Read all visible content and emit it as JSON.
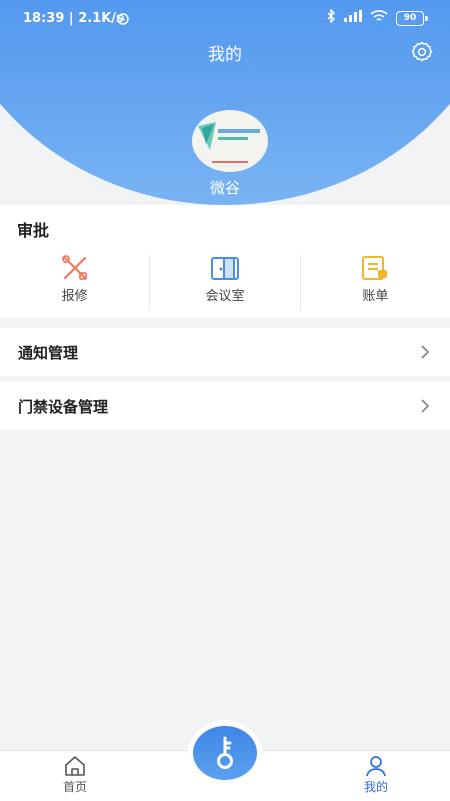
{
  "status_bar": {
    "time": "18:39",
    "network_speed": "2.1K/s",
    "battery": "90"
  },
  "header": {
    "title": "我的",
    "username": "微谷"
  },
  "approval": {
    "title": "审批",
    "items": [
      {
        "label": "报修",
        "icon": "wrench-screwdriver-icon",
        "color": "#ef7b5f"
      },
      {
        "label": "会议室",
        "icon": "door-icon",
        "color": "#4a8fe7"
      },
      {
        "label": "账单",
        "icon": "bill-icon",
        "color": "#f1b62e"
      }
    ]
  },
  "menu": [
    {
      "label": "通知管理"
    },
    {
      "label": "门禁设备管理"
    }
  ],
  "bottom_nav": {
    "items": [
      {
        "label": "首页",
        "active": false
      },
      {
        "label": "我的",
        "active": true
      }
    ]
  },
  "colors": {
    "primary": "#3a82e8",
    "active_tab": "#2f6fd8",
    "inactive_tab": "#555555"
  }
}
